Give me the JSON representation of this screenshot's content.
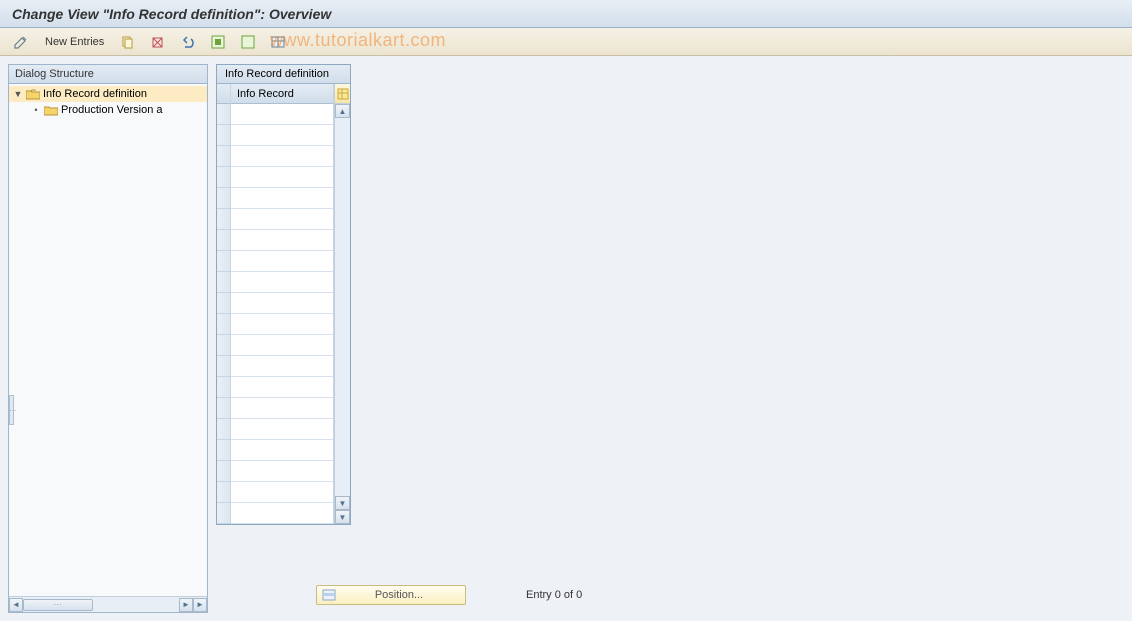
{
  "title": "Change View \"Info Record definition\": Overview",
  "toolbar": {
    "new_entries_label": "New Entries"
  },
  "watermark": "www.tutorialkart.com",
  "tree": {
    "header": "Dialog Structure",
    "nodes": [
      {
        "label": "Info Record definition",
        "expanded": true,
        "selected": true
      },
      {
        "label": "Production Version a",
        "expanded": false,
        "selected": false
      }
    ]
  },
  "table": {
    "title": "Info Record definition",
    "column_header": "Info Record",
    "row_count": 20
  },
  "footer": {
    "position_label": "Position...",
    "entry_text": "Entry 0 of 0"
  }
}
